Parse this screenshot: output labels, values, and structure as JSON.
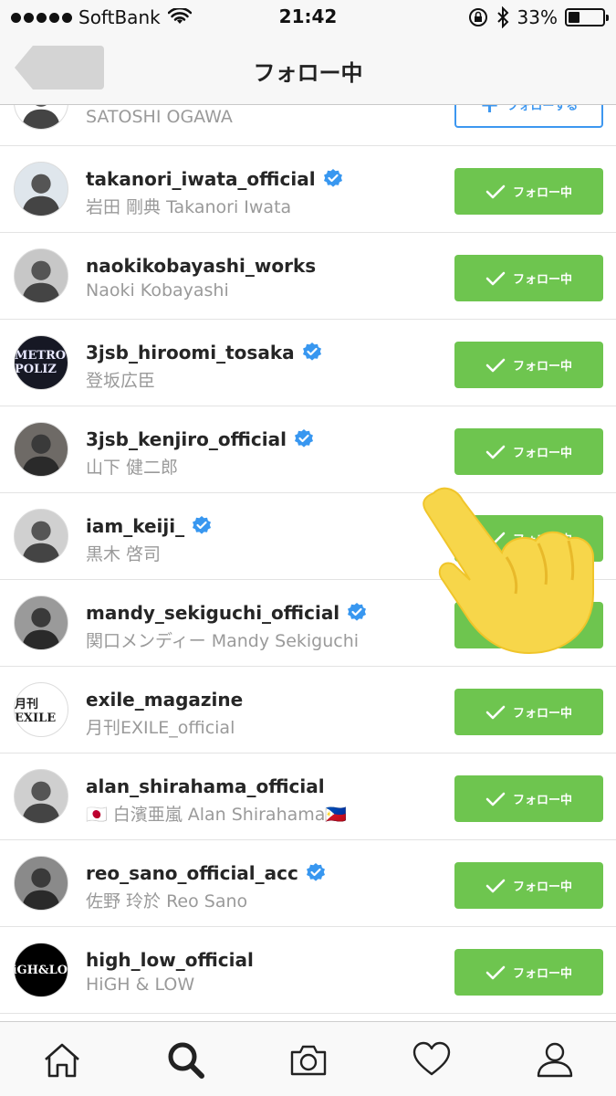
{
  "status_bar": {
    "carrier": "SoftBank",
    "time": "21:42",
    "battery_percent_text": "33%",
    "battery_level": 0.33,
    "signal_dots": 5
  },
  "nav": {
    "title": "フォロー中"
  },
  "rows": [
    {
      "username": "",
      "fullname": "SATOSHI OGAWA",
      "verified": false,
      "button_label": "フォローする",
      "button_state": "follow"
    },
    {
      "username": "takanori_iwata_official",
      "fullname": "岩田 剛典 Takanori Iwata",
      "verified": true,
      "button_label": "フォロー中",
      "button_state": "following"
    },
    {
      "username": "naokikobayashi_works",
      "fullname": "Naoki Kobayashi",
      "verified": false,
      "button_label": "フォロー中",
      "button_state": "following"
    },
    {
      "username": "3jsb_hiroomi_tosaka",
      "fullname": "登坂広臣",
      "verified": true,
      "button_label": "フォロー中",
      "button_state": "following",
      "avatar_text": "METRO POLIZ"
    },
    {
      "username": "3jsb_kenjiro_official",
      "fullname": "山下 健二郎",
      "verified": true,
      "button_label": "フォロー中",
      "button_state": "following"
    },
    {
      "username": "iam_keiji_",
      "fullname": "黒木 啓司",
      "verified": true,
      "button_label": "フォロー中",
      "button_state": "following"
    },
    {
      "username": "mandy_sekiguchi_official",
      "fullname": "関口メンディー Mandy Sekiguchi",
      "verified": true,
      "button_label": "フォロー中",
      "button_state": "following"
    },
    {
      "username": "exile_magazine",
      "fullname": "月刊EXILE_official",
      "verified": false,
      "button_label": "フォロー中",
      "button_state": "following",
      "avatar_text": "月刊EXILE"
    },
    {
      "username": "alan_shirahama_official",
      "fullname": "🇯🇵 白濱亜嵐 Alan Shirahama🇵🇭",
      "verified": false,
      "button_label": "フォロー中",
      "button_state": "following"
    },
    {
      "username": "reo_sano_official_acc",
      "fullname": "佐野 玲於 Reo Sano",
      "verified": true,
      "button_label": "フォロー中",
      "button_state": "following"
    },
    {
      "username": "high_low_official",
      "fullname": "HiGH & LOW",
      "verified": false,
      "button_label": "フォロー中",
      "button_state": "following",
      "avatar_text": "HiGH&LOW"
    }
  ],
  "tabs": [
    {
      "icon": "home-icon"
    },
    {
      "icon": "search-icon",
      "active": true
    },
    {
      "icon": "camera-icon"
    },
    {
      "icon": "heart-icon"
    },
    {
      "icon": "profile-icon"
    }
  ],
  "colors": {
    "following_green": "#6ec54f",
    "follow_blue": "#3d97f0",
    "verified_blue": "#3897f0"
  }
}
